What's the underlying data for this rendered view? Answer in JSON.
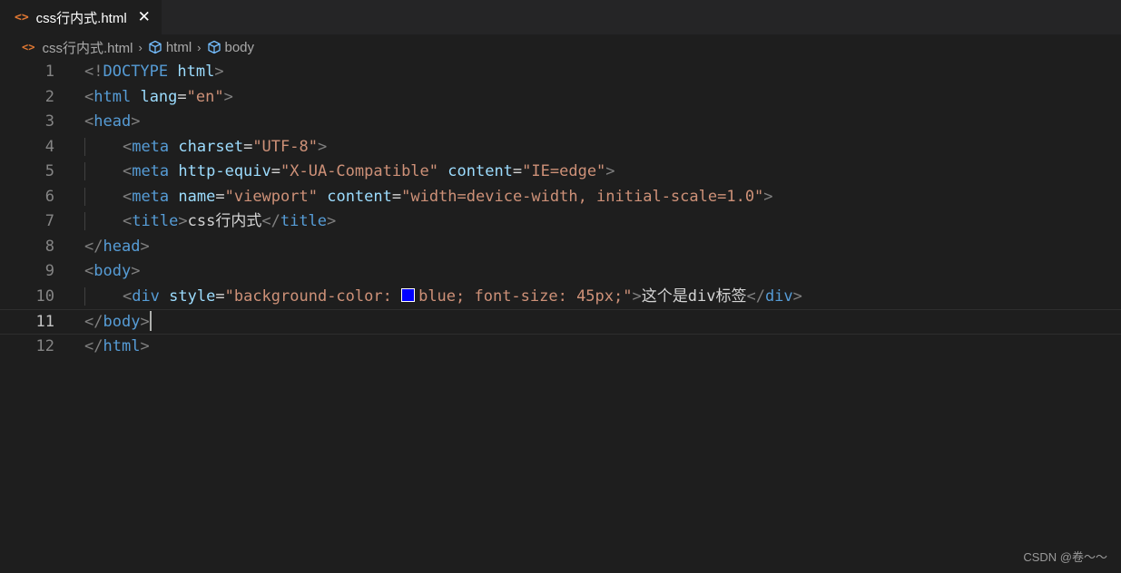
{
  "tab": {
    "title": "css行内式.html",
    "close": "✕",
    "file_icon": "<>"
  },
  "breadcrumb": {
    "file": "css行内式.html",
    "items": [
      "html",
      "body"
    ],
    "separator": "›"
  },
  "code": {
    "line_numbers": [
      "1",
      "2",
      "3",
      "4",
      "5",
      "6",
      "7",
      "8",
      "9",
      "10",
      "11",
      "12"
    ],
    "active_line": "11",
    "lines": [
      "<!DOCTYPE html>",
      "<html lang=\"en\">",
      "<head>",
      "    <meta charset=\"UTF-8\">",
      "    <meta http-equiv=\"X-UA-Compatible\" content=\"IE=edge\">",
      "    <meta name=\"viewport\" content=\"width=device-width, initial-scale=1.0\">",
      "    <title>css行内式</title>",
      "</head>",
      "<body>",
      "    <div style=\"background-color: blue; font-size: 45px;\">这个是div标签</div>",
      "</body>",
      "</html>"
    ]
  },
  "colors": {
    "swatch": "#0000ff",
    "tag": "#569cd6",
    "attr": "#9cdcfe",
    "string": "#ce9178"
  },
  "watermark": "CSDN @卷～～"
}
